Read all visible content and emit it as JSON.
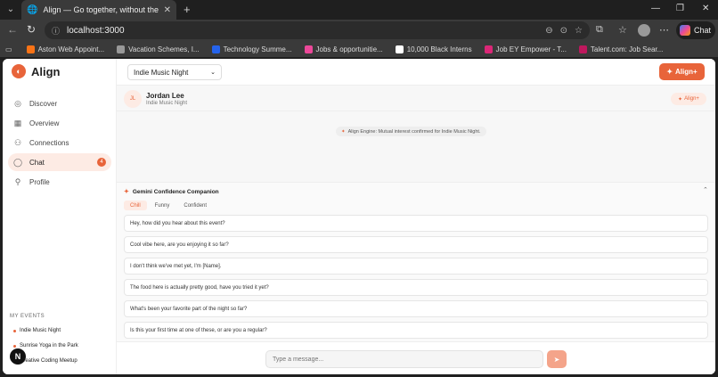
{
  "browser": {
    "tab_title": "Align — Go together, without the",
    "url": "localhost:3000",
    "copilot_label": "Chat",
    "bookmarks": [
      {
        "label": "Aston Web Appoint...",
        "color": "#f97316"
      },
      {
        "label": "Vacation Schemes, I...",
        "color": "#999999"
      },
      {
        "label": "Technology Summe...",
        "color": "#2563eb"
      },
      {
        "label": "Jobs & opportunitie...",
        "color": "#ec4899"
      },
      {
        "label": "10,000 Black Interns",
        "color": "#ffffff"
      },
      {
        "label": "Job EY Empower - T...",
        "color": "#db2777"
      },
      {
        "label": "Talent.com: Job Sear...",
        "color": "#be185d"
      }
    ]
  },
  "app": {
    "brand": "Align",
    "accent": "#e8643a",
    "nav": [
      {
        "label": "Discover",
        "icon": "compass-icon"
      },
      {
        "label": "Overview",
        "icon": "grid-icon"
      },
      {
        "label": "Connections",
        "icon": "users-icon"
      },
      {
        "label": "Chat",
        "icon": "chat-bubble-icon",
        "badge": "4",
        "active": true
      },
      {
        "label": "Profile",
        "icon": "user-icon"
      }
    ],
    "my_events_title": "MY EVENTS",
    "events": [
      "Indie Music Night",
      "Sunrise Yoga in the Park",
      "Creative Coding Meetup"
    ],
    "floating_button": "N",
    "event_select": "Indie Music Night",
    "align_plus_label": "Align+",
    "contact": {
      "initials": "JL",
      "name": "Jordan Lee",
      "event": "Indie Music Night",
      "align_label": "Align+"
    },
    "engine_message": "Align Engine: Mutual interest confirmed for Indie Music Night.",
    "companion": {
      "title": "Gemini Confidence Companion",
      "tabs": [
        "Chill",
        "Funny",
        "Confident"
      ],
      "suggestions": [
        "Hey, how did you hear about this event?",
        "Cool vibe here, are you enjoying it so far?",
        "I don't think we've met yet, I'm [Name].",
        "The food here is actually pretty good, have you tried it yet?",
        "What's been your favorite part of the night so far?",
        "Is this your first time at one of these, or are you a regular?"
      ]
    },
    "message_placeholder": "Type a message..."
  }
}
